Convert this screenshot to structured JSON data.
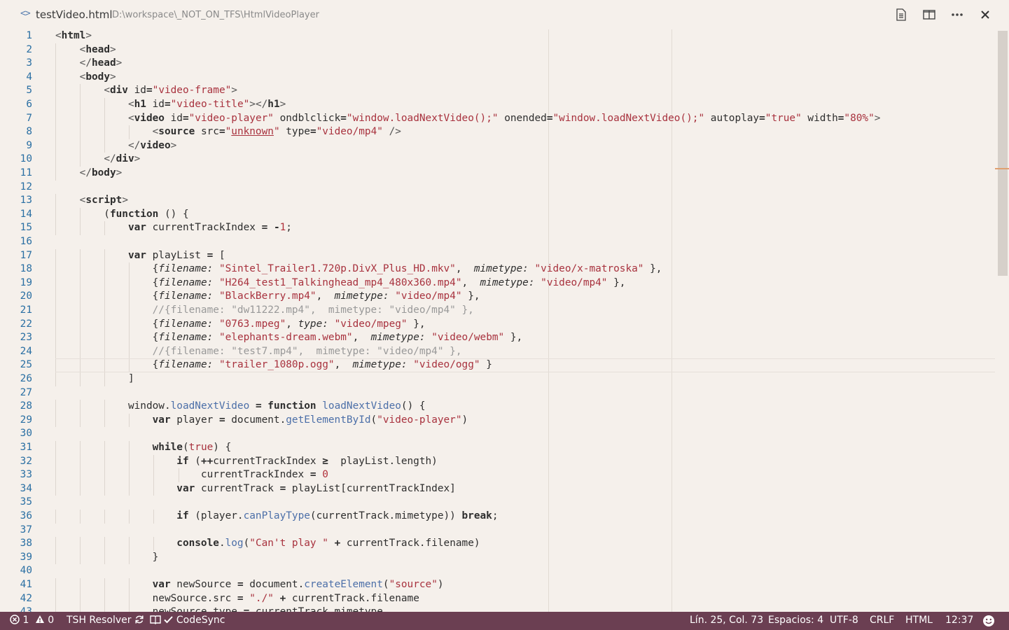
{
  "titlebar": {
    "file_icon": "<>",
    "filename": "testVideo.html",
    "path": "D:\\workspace\\_NOT_ON_TFS\\HtmlVideoPlayer",
    "actions": [
      "open-preview-icon",
      "split-editor-icon",
      "more-actions-icon",
      "close-icon"
    ]
  },
  "editor": {
    "current_line": 25,
    "lines": [
      "<html>",
      "    <head>",
      "    </head>",
      "    <body>",
      "        <div id=\"video-frame\">",
      "            <h1 id=\"video-title\"></h1>",
      "            <video id=\"video-player\" ondblclick=\"window.loadNextVideo();\" onended=\"window.loadNextVideo();\" autoplay=\"true\" width=\"80%\">",
      "                <source src=\"unknown\" type=\"video/mp4\" />",
      "            </video>",
      "        </div>",
      "    </body>",
      "",
      "    <script>",
      "        (function () {",
      "            var currentTrackIndex = -1;",
      "",
      "            var playList = [",
      "                {filename: \"Sintel_Trailer1.720p.DivX_Plus_HD.mkv\",  mimetype: \"video/x-matroska\" },",
      "                {filename: \"H264_test1_Talkinghead_mp4_480x360.mp4\",  mimetype: \"video/mp4\" },",
      "                {filename: \"BlackBerry.mp4\",  mimetype: \"video/mp4\" },",
      "                //{filename: \"dw11222.mp4\",  mimetype: \"video/mp4\" },",
      "                {filename: \"0763.mpeg\", type: \"video/mpeg\" },",
      "                {filename: \"elephants-dream.webm\",  mimetype: \"video/webm\" },",
      "                //{filename: \"test7.mp4\",  mimetype: \"video/mp4\" },",
      "                {filename: \"trailer_1080p.ogg\",  mimetype: \"video/ogg\" }",
      "            ]",
      "",
      "            window.loadNextVideo = function loadNextVideo() {",
      "                var player = document.getElementById(\"video-player\")",
      "",
      "                while(true) {",
      "                    if (++currentTrackIndex >= playList.length)",
      "                        currentTrackIndex = 0",
      "                    var currentTrack = playList[currentTrackIndex]",
      "",
      "                    if (player.canPlayType(currentTrack.mimetype)) break;",
      "",
      "                    console.log(\"Can't play \" + currentTrack.filename)",
      "                }",
      "",
      "                var newSource = document.createElement(\"source\")",
      "                newSource.src = \"./\" + currentTrack.filename",
      "                newSource.type = currentTrack.mimetype"
    ]
  },
  "statusbar": {
    "errors": "1",
    "warnings": "0",
    "tsh_resolver": "TSH Resolver",
    "codesync": "CodeSync",
    "position": "Lín. 25, Col. 73",
    "spaces": "Espacios: 4",
    "encoding": "UTF-8",
    "eol": "CRLF",
    "language": "HTML",
    "time": "12:37"
  },
  "colors": {
    "background": "#f5f0eb",
    "statusbar": "#6b3f52",
    "keyword": "#1a1a1a",
    "string": "#a8323e",
    "attribute": "#2e2e2e",
    "method": "#4c6fa8",
    "comment": "#999999",
    "number": "#b0303a",
    "line_number": "#2a6fa3"
  }
}
